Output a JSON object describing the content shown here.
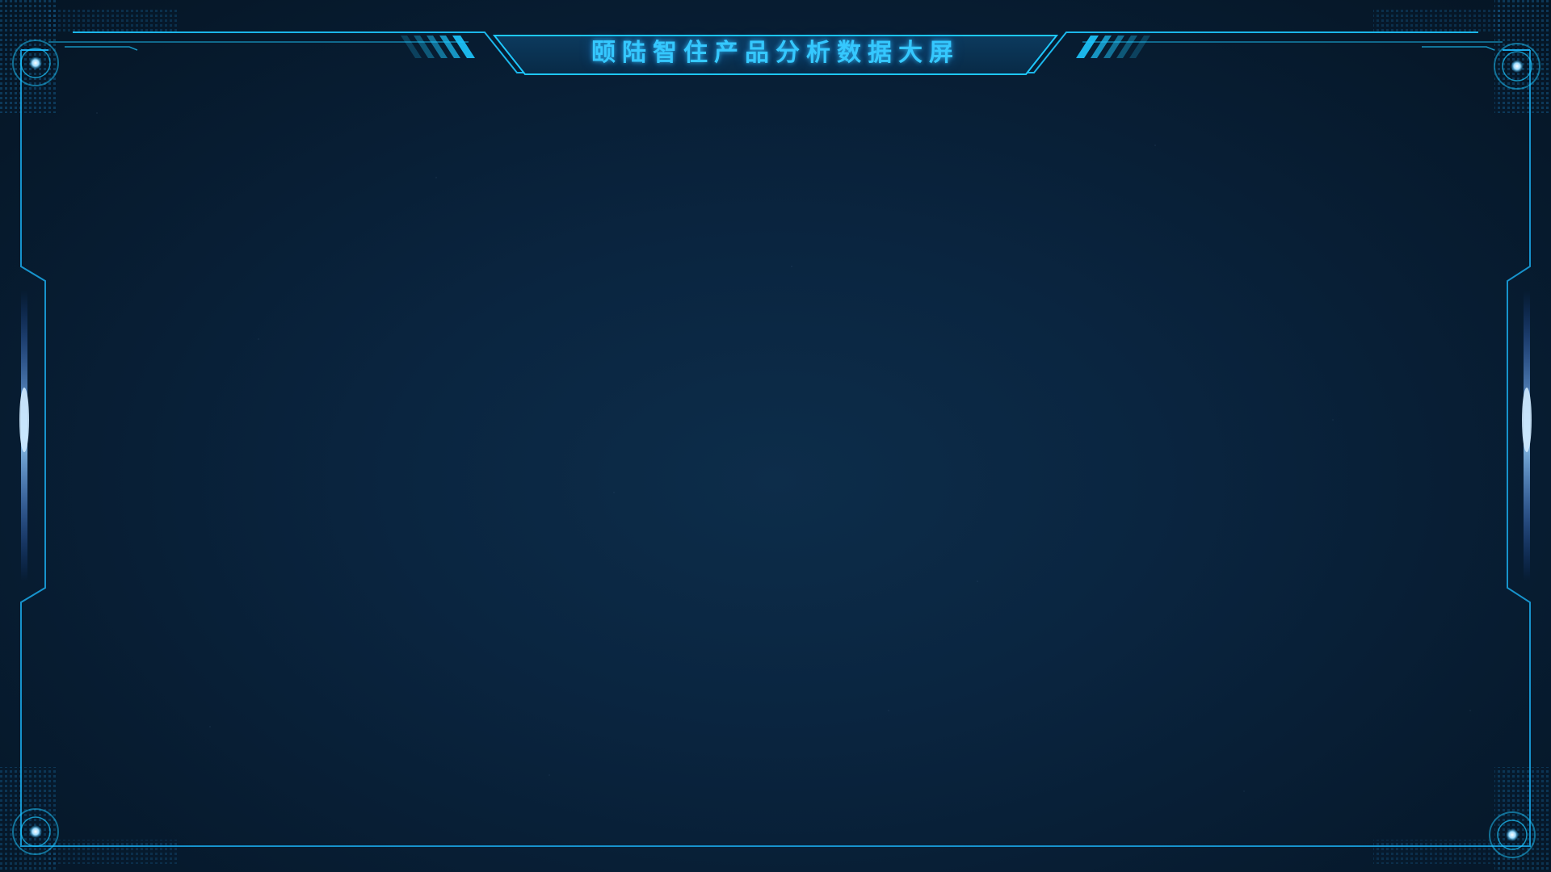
{
  "screen": {
    "title": "颐陆智住产品分析数据大屏"
  },
  "theme": {
    "accent": "#1ec8ff",
    "frame_line": "#1aa8e8",
    "glow": "#2a6cff",
    "background": "#0a2540"
  },
  "icons": {
    "corner": "radar-target-icon",
    "side_glow": "light-beam-icon",
    "stripes": "stripe-decoration-icon"
  }
}
